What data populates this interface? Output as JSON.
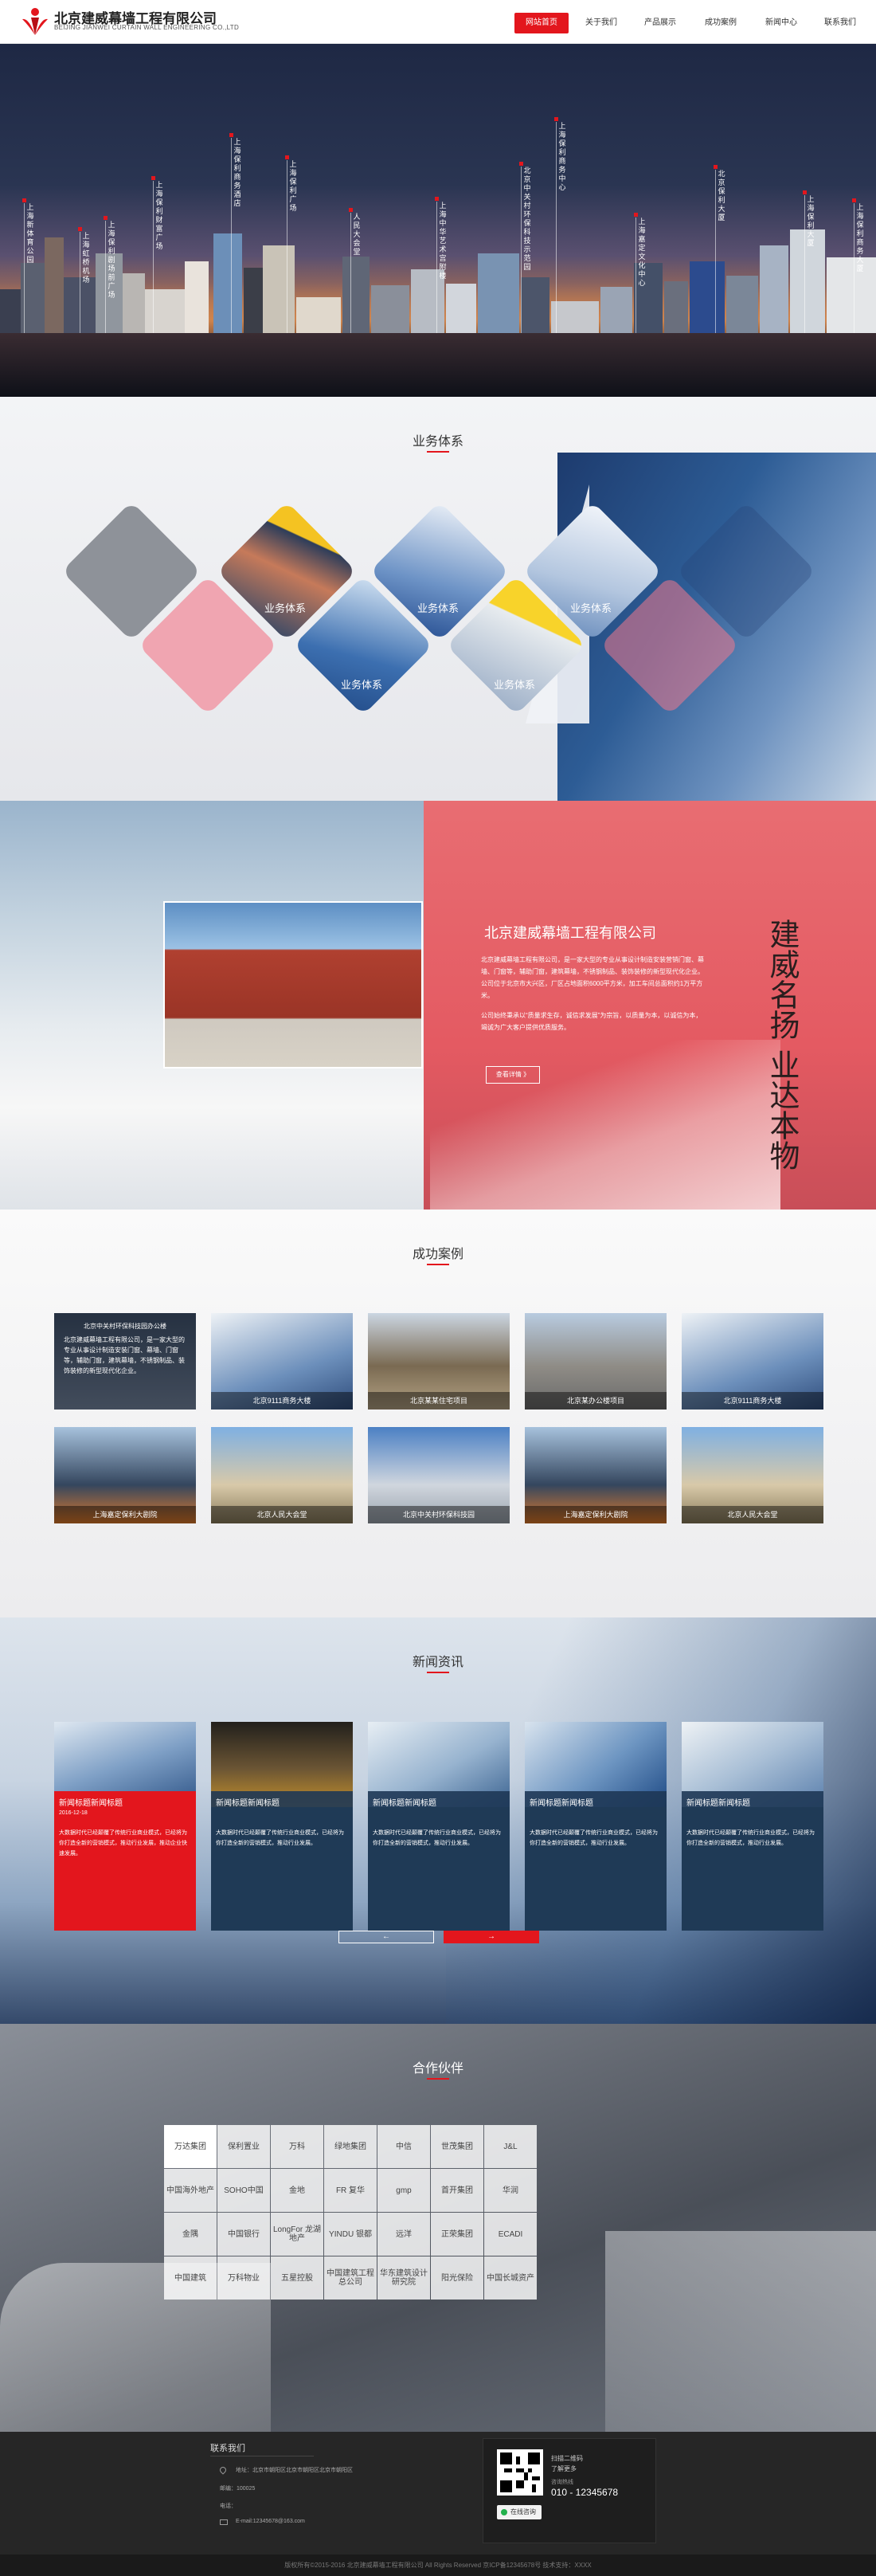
{
  "header": {
    "company_name": "北京建威幕墙工程有限公司",
    "company_name_en": "BEIJING JIANWEI CURTAIN WALL ENGINEERING CO.,LTD",
    "nav": [
      "网站首页",
      "关于我们",
      "产品展示",
      "成功案例",
      "新闻中心",
      "联系我们"
    ],
    "active_nav": 0,
    "accent_color": "#e3161d"
  },
  "banner": {
    "projects": [
      "上海新体育公园",
      "上海虹桥机场",
      "上海保利剧场前广场",
      "上海保利财富广场",
      "上海保利商务酒店",
      "上海保利广场",
      "人民大会堂",
      "上海中华艺术宫附楼",
      "北京中关村环保科技示范园",
      "上海保利商务中心",
      "上海嘉定文化中心",
      "北京保利大厦",
      "上海保利大厦",
      "上海保利商务大厦"
    ],
    "slide_count": 5,
    "active_slide": 0
  },
  "business": {
    "title": "业务体系",
    "items": [
      "业务体系",
      "业务体系",
      "业务体系",
      "业务体系",
      "业务体系"
    ]
  },
  "about": {
    "company": "北京建威幕墙工程有限公司",
    "para1": "北京建威幕墙工程有限公司，是一家大型的专业从事设计制造安装营销门窗、幕墙、门窗等，辅助门窗，建筑幕墙，不锈钢制品、装饰装修的新型现代化企业。公司位于北京市大兴区，厂区占地面积6000平方米，加工车间总面积约1万平方米。",
    "para2": "公司始终秉承以“质量求生存，诚信求发展”为宗旨，以质量为本，以诚信为本，竭诚为广大客户提供优质服务。",
    "more": "查看详情 》",
    "calligraphy": "建威名扬 业达本物"
  },
  "cases": {
    "title": "成功案例",
    "items": [
      {
        "name": "北京中关村环保科技园办公楼",
        "desc": "北京建威幕墙工程有限公司，是一家大型的专业从事设计制造安装门窗、幕墙、门窗等，辅助门窗，建筑幕墙，不锈钢制品、装饰装修的新型现代化企业。"
      },
      {
        "name": "北京9111商务大楼"
      },
      {
        "name": "北京某某住宅项目"
      },
      {
        "name": "北京某办公楼项目"
      },
      {
        "name": "北京9111商务大楼"
      },
      {
        "name": "上海嘉定保利大剧院"
      },
      {
        "name": "北京人民大会堂"
      },
      {
        "name": "北京中关村环保科技园"
      },
      {
        "name": "上海嘉定保利大剧院"
      },
      {
        "name": "北京人民大会堂"
      }
    ]
  },
  "news": {
    "title": "新闻资讯",
    "items": [
      {
        "title": "新闻标题新闻标题",
        "date": "2016-12-18",
        "summary": "大数据时代已经颠覆了传统行业商业模式，已经将为你打造全新的营销模式，推动行业发展，推动企业快速发展。"
      },
      {
        "title": "新闻标题新闻标题",
        "date": "",
        "summary": "大数据时代已经颠覆了传统行业商业模式，已经将为你打造全新的营销模式，推动行业发展。"
      },
      {
        "title": "新闻标题新闻标题",
        "date": "",
        "summary": "大数据时代已经颠覆了传统行业商业模式，已经将为你打造全新的营销模式，推动行业发展。"
      },
      {
        "title": "新闻标题新闻标题",
        "date": "",
        "summary": "大数据时代已经颠覆了传统行业商业模式，已经将为你打造全新的营销模式，推动行业发展。"
      },
      {
        "title": "新闻标题新闻标题",
        "date": "",
        "summary": "大数据时代已经颠覆了传统行业商业模式，已经将为你打造全新的营销模式，推动行业发展。"
      }
    ],
    "prev": "←",
    "next": "→"
  },
  "partners": {
    "title": "合作伙伴",
    "logos": [
      "万达集团",
      "保利置业",
      "万科",
      "绿地集团",
      "中信",
      "世茂集团",
      "J&L",
      "中国海外地产",
      "SOHO中国",
      "金地",
      "FR 复华",
      "gmp",
      "首开集团",
      "华润",
      "金隅",
      "中国银行",
      "LongFor 龙湖地产",
      "YINDU 银都",
      "远洋",
      "正荣集团",
      "ECADI",
      "中国建筑",
      "万科物业",
      "五星控股",
      "中国建筑工程总公司",
      "华东建筑设计研究院",
      "阳光保险",
      "中国长城资产"
    ]
  },
  "footer": {
    "contact_title": "联系我们",
    "address": "地址：北京市朝阳区北京市朝阳区北京市朝阳区",
    "postcode": "邮编：100025",
    "phone_label": "电话：",
    "email": "E-mail:12345678@163.com",
    "qr_text_1": "扫描二维码",
    "qr_text_2": "了解更多",
    "hotline_label": "咨询热线",
    "hotline": "010 - 12345678",
    "online": "在线咨询",
    "copyright": "版权所有©2015-2016 北京建威幕墙工程有限公司 All Rights Reserved 京ICP备12345678号 技术支持：XXXX"
  }
}
